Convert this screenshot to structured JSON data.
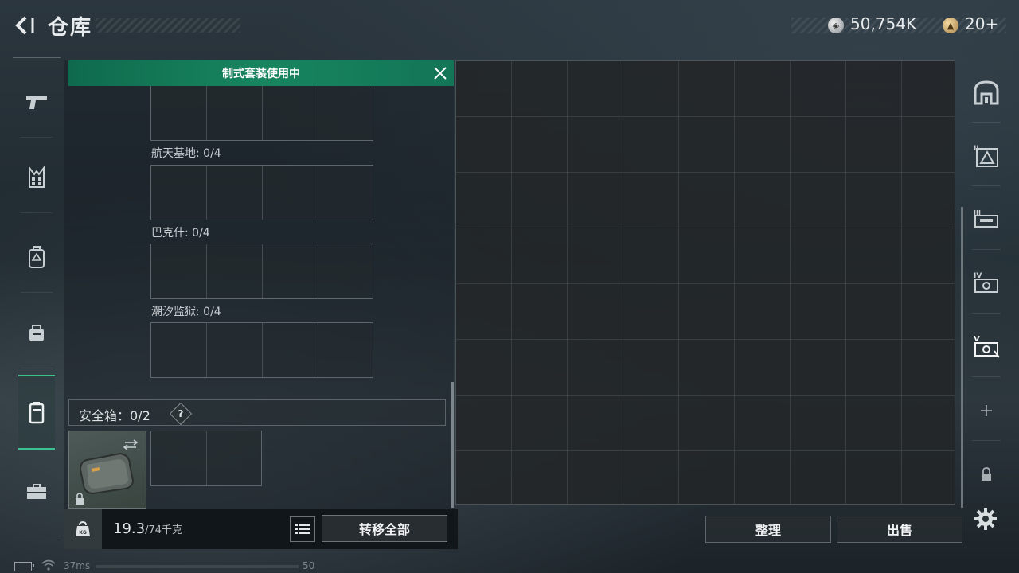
{
  "header": {
    "title": "仓库",
    "currencies": [
      {
        "icon": "silver-coin-icon",
        "value": "50,754K"
      },
      {
        "icon": "gold-coin-icon",
        "value": "20+"
      }
    ]
  },
  "left_sidebar": {
    "categories": [
      {
        "name": "weapons",
        "icon": "pistol-icon",
        "active": false
      },
      {
        "name": "armor",
        "icon": "vest-icon",
        "active": false
      },
      {
        "name": "backpack",
        "icon": "backpack-icon",
        "active": false
      },
      {
        "name": "helmet",
        "icon": "helmet-icon",
        "active": false
      },
      {
        "name": "container",
        "icon": "case-icon",
        "active": true
      },
      {
        "name": "toolbox",
        "icon": "toolbox-icon",
        "active": false
      }
    ]
  },
  "inventory": {
    "banner": "制式套装使用中",
    "slot_sections": [
      {
        "label": "航天基地: 0/4"
      },
      {
        "label": "巴克什: 0/4"
      },
      {
        "label": "潮汐监狱: 0/4"
      }
    ],
    "safe_box": {
      "label": "安全箱：0/2",
      "help": "?"
    },
    "weight": {
      "current": "19.3",
      "max": "/74千克",
      "icon_text": "KG"
    },
    "transfer_all": "转移全部"
  },
  "storage": {
    "actions": {
      "sort": "整理",
      "sell": "出售"
    },
    "tabs": [
      {
        "icon": "warehouse-home-icon"
      },
      {
        "icon": "warehouse-ii-icon",
        "numeral": "II"
      },
      {
        "icon": "warehouse-iii-icon",
        "numeral": "III"
      },
      {
        "icon": "warehouse-iv-icon",
        "numeral": "IV"
      },
      {
        "icon": "warehouse-v-icon",
        "numeral": "V",
        "active": true
      },
      {
        "icon": "add-warehouse-icon"
      },
      {
        "icon": "locked-warehouse-icon"
      }
    ]
  },
  "status": {
    "ping": "37ms",
    "fps": "50"
  },
  "colors": {
    "accent_green": "#17855f",
    "panel_dark": "#1a2126"
  }
}
